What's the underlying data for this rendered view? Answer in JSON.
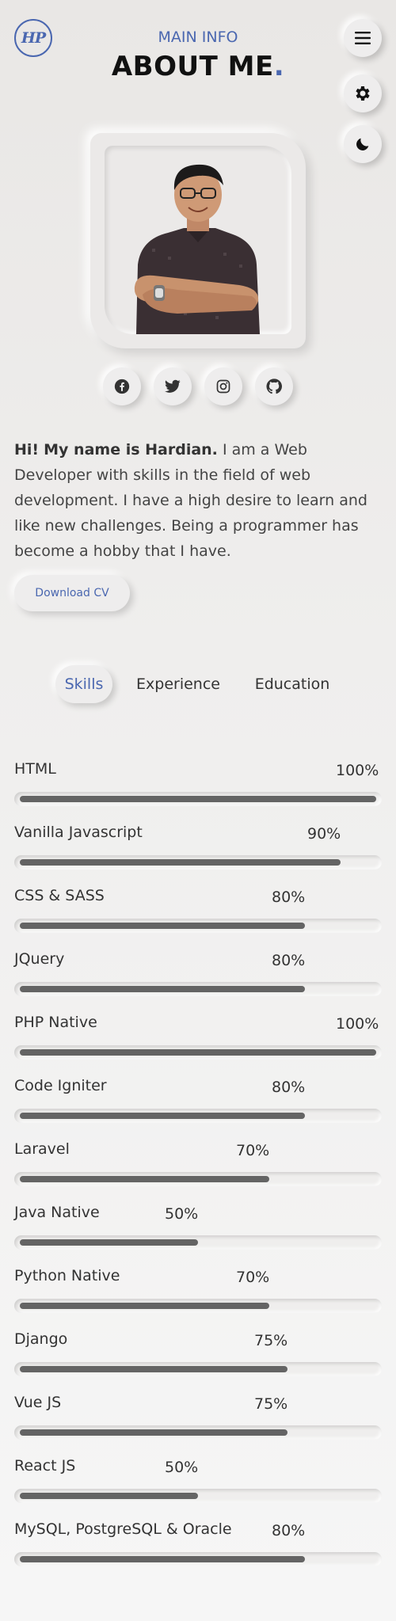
{
  "header": {
    "logo_text": "HP",
    "subtitle": "MAIN INFO",
    "title": "ABOUT ME",
    "title_dot": "."
  },
  "controls": {
    "menu_icon": "hamburger-menu-icon",
    "settings_icon": "gear-icon",
    "theme_icon": "moon-icon"
  },
  "social": [
    {
      "name": "facebook",
      "icon": "facebook-icon"
    },
    {
      "name": "twitter",
      "icon": "twitter-icon"
    },
    {
      "name": "instagram",
      "icon": "instagram-icon"
    },
    {
      "name": "github",
      "icon": "github-icon"
    }
  ],
  "bio": {
    "greeting": "Hi!",
    "intro": "My name is Hardian.",
    "text": "I am a Web Developer with skills in the field of web development. I have a high desire to learn and like new challenges. Being a programmer has become a hobby that I have."
  },
  "cv_button": "Download CV",
  "tabs": [
    {
      "label": "Skills",
      "active": true
    },
    {
      "label": "Experience",
      "active": false
    },
    {
      "label": "Education",
      "active": false
    }
  ],
  "skills": [
    {
      "name": "HTML",
      "percent_label": "100%",
      "level": 100
    },
    {
      "name": "Vanilla Javascript",
      "percent_label": "90%",
      "level": 90
    },
    {
      "name": "CSS & SASS",
      "percent_label": "80%",
      "level": 80
    },
    {
      "name": "JQuery",
      "percent_label": "80%",
      "level": 80
    },
    {
      "name": "PHP Native",
      "percent_label": "100%",
      "level": 100
    },
    {
      "name": "Code Igniter",
      "percent_label": "80%",
      "level": 80
    },
    {
      "name": "Laravel",
      "percent_label": "70%",
      "level": 70
    },
    {
      "name": "Java Native",
      "percent_label": "50%",
      "level": 50
    },
    {
      "name": "Python Native",
      "percent_label": "70%",
      "level": 70
    },
    {
      "name": "Django",
      "percent_label": "75%",
      "level": 75
    },
    {
      "name": "Vue JS",
      "percent_label": "75%",
      "level": 75
    },
    {
      "name": "React JS",
      "percent_label": "50%",
      "level": 50
    },
    {
      "name": "MySQL, PostgreSQL & Oracle",
      "percent_label": "80%",
      "level": 80
    }
  ],
  "colors": {
    "accent": "#4a67b0",
    "bar_fill": "#646464",
    "background": "#eeeded"
  }
}
